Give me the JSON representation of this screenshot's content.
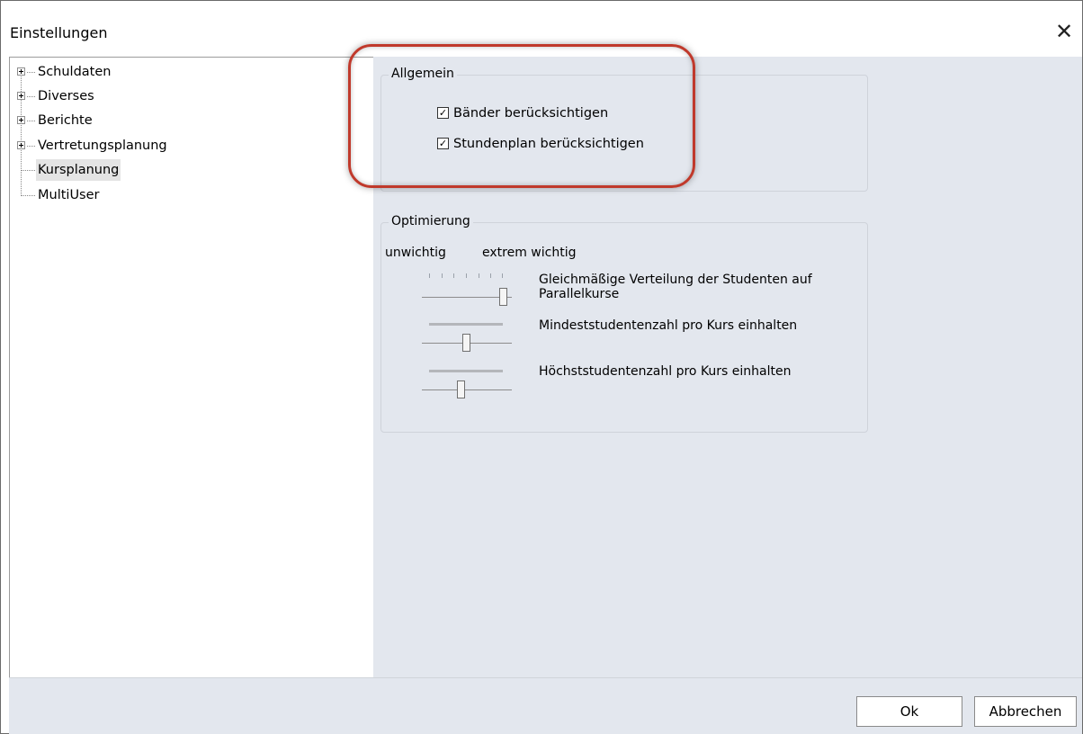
{
  "window": {
    "title": "Einstellungen"
  },
  "tree": {
    "items": [
      {
        "label": "Schuldaten",
        "expandable": true
      },
      {
        "label": "Diverses",
        "expandable": true
      },
      {
        "label": "Berichte",
        "expandable": true
      },
      {
        "label": "Vertretungsplanung",
        "expandable": true
      },
      {
        "label": "Kursplanung",
        "expandable": false,
        "selected": true
      },
      {
        "label": "MultiUser",
        "expandable": false
      }
    ]
  },
  "allgemein": {
    "title": "Allgemein",
    "options": [
      {
        "label": "Bänder berücksichtigen",
        "checked": true
      },
      {
        "label": "Stundenplan berücksichtigen",
        "checked": true
      }
    ]
  },
  "optimierung": {
    "title": "Optimierung",
    "low_label": "unwichtig",
    "high_label": "extrem wichtig",
    "sliders": [
      {
        "label": "Gleichmäßige Verteilung der Studenten auf Parallelkurse",
        "level": 1.0
      },
      {
        "label": "Mindeststudentenzahl pro Kurs einhalten",
        "level": 0.5
      },
      {
        "label": "Höchststudentenzahl pro Kurs einhalten",
        "level": 0.43
      }
    ]
  },
  "footer": {
    "ok_label": "Ok",
    "cancel_label": "Abbrechen"
  },
  "colors": {
    "annotation": "#c0392b",
    "content_bg": "#e3e7ee"
  }
}
